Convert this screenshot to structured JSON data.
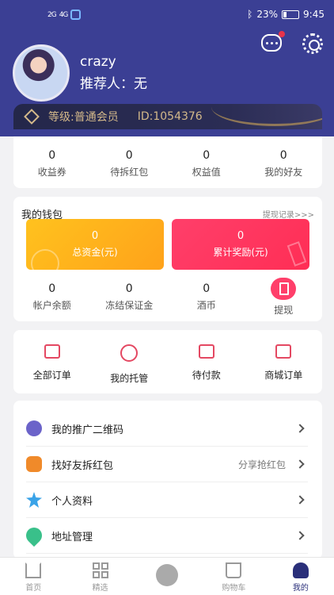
{
  "status_bar": {
    "signal_left": "2G",
    "signal_mid": "4G",
    "battery": "23%",
    "time": "9:45"
  },
  "profile": {
    "username": "crazy",
    "referrer": "推荐人：无",
    "level": "等级:普通会员",
    "id": "ID:1054376"
  },
  "stats": [
    {
      "value": "0",
      "label": "收益券"
    },
    {
      "value": "0",
      "label": "待拆红包"
    },
    {
      "value": "0",
      "label": "权益值"
    },
    {
      "value": "0",
      "label": "我的好友"
    }
  ],
  "wallet": {
    "title": "我的钱包",
    "record_link": "提现记录>>>",
    "total": {
      "value": "0",
      "label": "总资金(元)"
    },
    "reward": {
      "value": "0",
      "label": "累计奖励(元)"
    },
    "items": [
      {
        "value": "0",
        "label": "帐户余额"
      },
      {
        "value": "0",
        "label": "冻结保证金"
      },
      {
        "value": "0",
        "label": "酒币"
      }
    ],
    "withdraw_label": "提现"
  },
  "orders": [
    {
      "label": "全部订单",
      "icon": "all-orders-icon"
    },
    {
      "label": "我的托管",
      "icon": "custody-icon"
    },
    {
      "label": "待付款",
      "icon": "pending-payment-icon"
    },
    {
      "label": "商城订单",
      "icon": "mall-order-icon"
    }
  ],
  "menu": [
    {
      "label": "我的推广二维码",
      "extra": ""
    },
    {
      "label": "找好友拆红包",
      "extra": "分享抢红包"
    },
    {
      "label": "个人资料",
      "extra": ""
    },
    {
      "label": "地址管理",
      "extra": ""
    }
  ],
  "tabs": [
    {
      "label": "首页"
    },
    {
      "label": "精选"
    },
    {
      "label": ""
    },
    {
      "label": "购物车"
    },
    {
      "label": "我的"
    }
  ]
}
